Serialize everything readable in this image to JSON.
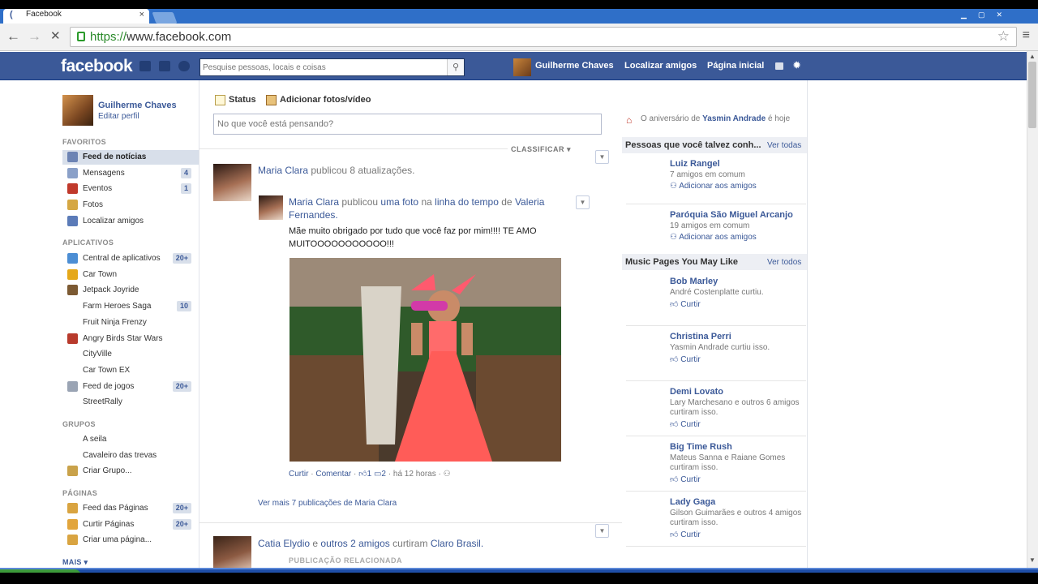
{
  "browser": {
    "tab_title": "Facebook",
    "tab_close": "×",
    "url_scheme": "https://",
    "url_rest": "www.facebook.com",
    "star": "☆",
    "menu": "≡",
    "back": "←",
    "forward": "→",
    "stop": "✕"
  },
  "topbar": {
    "logo": "facebook",
    "search_placeholder": "Pesquise pessoas, locais e coisas",
    "user": "Guilherme Chaves",
    "find_friends": "Localizar amigos",
    "home": "Página inicial"
  },
  "left": {
    "profile_name": "Guilherme Chaves",
    "edit_profile": "Editar perfil",
    "sections": {
      "favorites": "FAVORITOS",
      "apps": "APLICATIVOS",
      "groups": "GRUPOS",
      "pages": "PÁGINAS",
      "more": "MAIS ▾"
    },
    "favorites": [
      {
        "label": "Feed de notícias",
        "count": "",
        "color": "#6d84b4"
      },
      {
        "label": "Mensagens",
        "count": "4",
        "color": "#8aa0c8"
      },
      {
        "label": "Eventos",
        "count": "1",
        "color": "#c0392b"
      },
      {
        "label": "Fotos",
        "count": "",
        "color": "#d5a743"
      },
      {
        "label": "Localizar amigos",
        "count": "",
        "color": "#5b7bb8"
      }
    ],
    "apps": [
      {
        "label": "Central de aplicativos",
        "count": "20+",
        "color": "#4c8ed4"
      },
      {
        "label": "Car Town",
        "count": "",
        "color": "#e5a81a"
      },
      {
        "label": "Jetpack Joyride",
        "count": "",
        "color": "#7c5a33"
      },
      {
        "label": "Farm Heroes Saga",
        "count": "10",
        "color": ""
      },
      {
        "label": "Fruit Ninja Frenzy",
        "count": "",
        "color": ""
      },
      {
        "label": "Angry Birds Star Wars",
        "count": "",
        "color": "#b83a2c"
      },
      {
        "label": "CityVille",
        "count": "",
        "color": ""
      },
      {
        "label": "Car Town EX",
        "count": "",
        "color": ""
      },
      {
        "label": "Feed de jogos",
        "count": "20+",
        "color": "#9aa4b4"
      },
      {
        "label": "StreetRally",
        "count": "",
        "color": ""
      }
    ],
    "groups": [
      {
        "label": "A seila",
        "count": "",
        "color": ""
      },
      {
        "label": "Cavaleiro das trevas",
        "count": "",
        "color": ""
      },
      {
        "label": "Criar Grupo...",
        "count": "",
        "color": "#c9a24a"
      }
    ],
    "pages": [
      {
        "label": "Feed das Páginas",
        "count": "20+",
        "color": "#d9a441"
      },
      {
        "label": "Curtir Páginas",
        "count": "20+",
        "color": "#e2a53c"
      },
      {
        "label": "Criar uma página...",
        "count": "",
        "color": "#d9a441"
      }
    ]
  },
  "composer": {
    "status": "Status",
    "photo": "Adicionar fotos/vídeo",
    "placeholder": "No que você está pensando?",
    "sort": "CLASSIFICAR ▾"
  },
  "feed": {
    "post1_name": "Maria Clara",
    "post1_rest": "publicou 8 atualizações.",
    "sub_name": "Maria Clara",
    "sub_mid1": "publicou",
    "sub_link": "uma foto",
    "sub_mid2": "na",
    "sub_link2": "linha do tempo",
    "sub_mid3": "de",
    "sub_target": "Valeria Fernandes.",
    "message": "Mãe muito obrigado por tudo que você faz por mim!!!! TE AMO MUITOOOOOOOOOOO!!!",
    "actions": {
      "like": "Curtir",
      "sep": "·",
      "comment": "Comentar",
      "likes": "1",
      "comments": "2",
      "time": "há 12 horas"
    },
    "see_more": "Ver mais 7 publicações de Maria Clara",
    "post2_name": "Catia Elydio",
    "post2_mid": "e",
    "post2_others": "outros 2 amigos",
    "post2_rest": "curtiram",
    "post2_page": "Claro Brasil.",
    "related": "PUBLICAÇÃO RELACIONADA"
  },
  "right": {
    "birthday_pre": "O aniversário de",
    "birthday_name": "Yasmin Andrade",
    "birthday_post": "é hoje",
    "pymk_title": "Pessoas que você talvez conh...",
    "see_all": "Ver todas",
    "pymk": [
      {
        "name": "Luiz Rangel",
        "sub": "7 amigos em comum",
        "action": "Adicionar aos amigos"
      },
      {
        "name": "Paróquia São Miguel Arcanjo",
        "sub": "19 amigos em comum",
        "action": "Adicionar aos amigos"
      }
    ],
    "music_title": "Music Pages You May Like",
    "see_all2": "Ver todos",
    "music": [
      {
        "name": "Bob Marley",
        "sub": "André Costenplatte curtiu.",
        "action": "Curtir"
      },
      {
        "name": "Christina Perri",
        "sub": "Yasmin Andrade curtiu isso.",
        "action": "Curtir"
      },
      {
        "name": "Demi Lovato",
        "sub": "Lary Marchesano e outros 6 amigos curtiram isso.",
        "action": "Curtir"
      },
      {
        "name": "Big Time Rush",
        "sub": "Mateus Sanna e Raiane Gomes curtiram isso.",
        "action": "Curtir"
      },
      {
        "name": "Lady Gaga",
        "sub": "Gilson Guimarães e outros 4 amigos curtiram isso.",
        "action": "Curtir"
      }
    ]
  }
}
